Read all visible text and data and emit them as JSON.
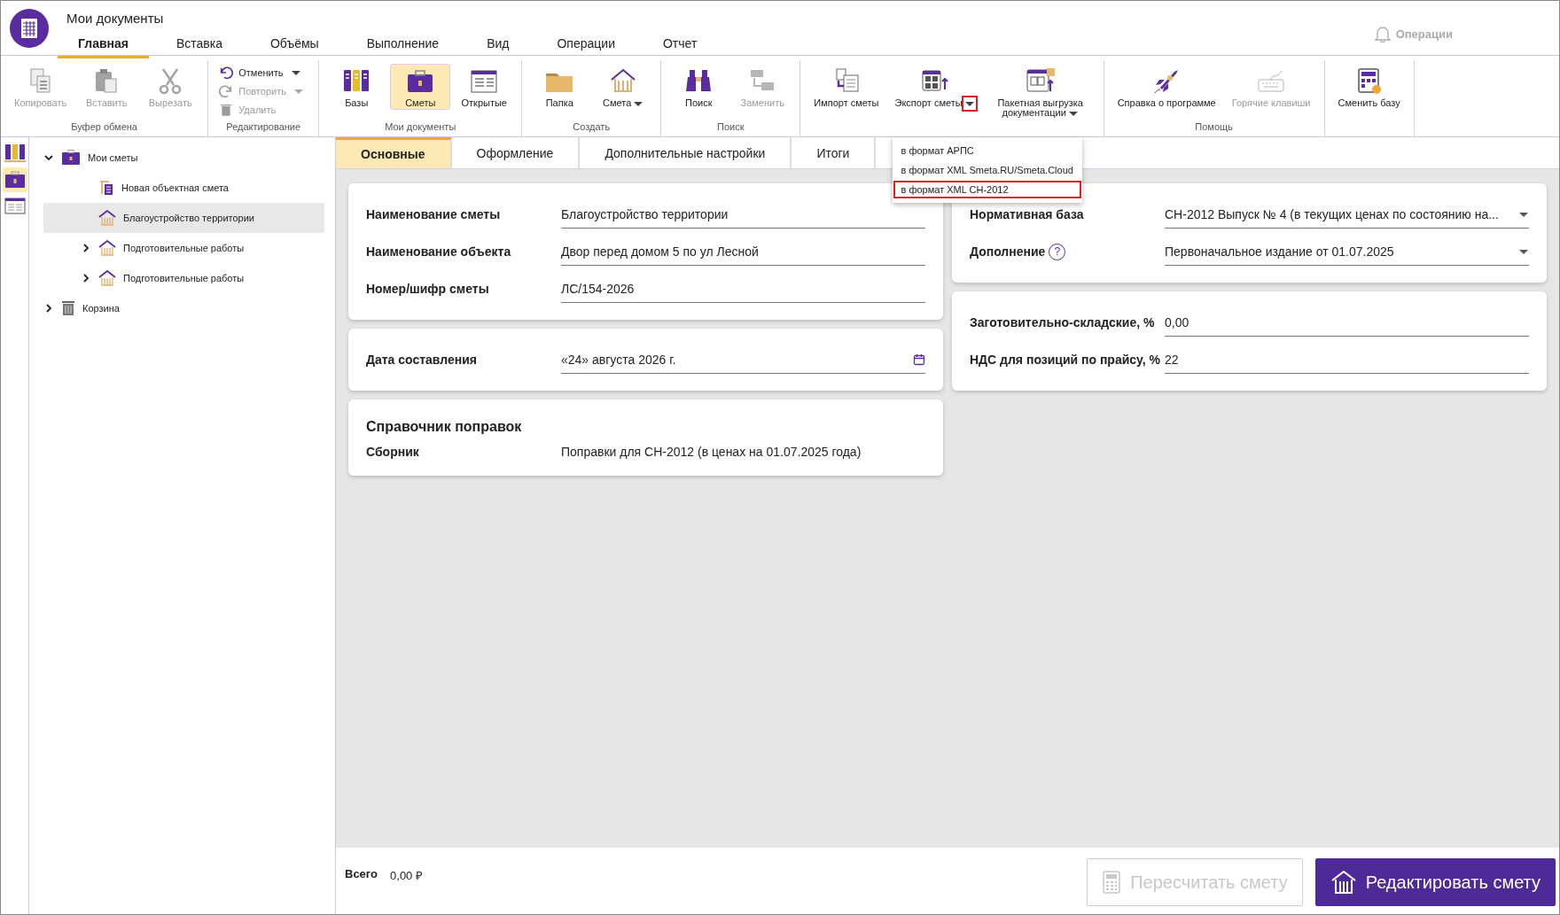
{
  "app": {
    "title": "Мои документы"
  },
  "menu_tabs": [
    {
      "label": "Главная",
      "selected": true
    },
    {
      "label": "Вставка",
      "selected": false
    },
    {
      "label": "Объёмы",
      "selected": false
    },
    {
      "label": "Выполнение",
      "selected": false
    },
    {
      "label": "Вид",
      "selected": false
    },
    {
      "label": "Операции",
      "selected": false
    },
    {
      "label": "Отчет",
      "selected": false
    }
  ],
  "notifications": {
    "label": "Операции"
  },
  "ribbon": {
    "groups": [
      {
        "label": "Буфер обмена",
        "kind": "large",
        "items": [
          {
            "label": "Копировать",
            "disabled": true
          },
          {
            "label": "Вставить",
            "disabled": true
          },
          {
            "label": "Вырезать",
            "disabled": true
          }
        ]
      },
      {
        "label": "Редактирование",
        "kind": "small",
        "items": [
          {
            "label": "Отменить",
            "disabled": false,
            "dropdown": true
          },
          {
            "label": "Повторить",
            "disabled": true,
            "dropdown": true
          },
          {
            "label": "Удалить",
            "disabled": true
          }
        ]
      },
      {
        "label": "Мои документы",
        "kind": "large",
        "items": [
          {
            "label": "Базы",
            "disabled": false,
            "selected": false
          },
          {
            "label": "Сметы",
            "disabled": false,
            "selected": true
          },
          {
            "label": "Открытые",
            "disabled": false,
            "selected": false
          }
        ]
      },
      {
        "label": "Создать",
        "kind": "large",
        "items": [
          {
            "label": "Папка",
            "disabled": false
          },
          {
            "label": "Смета",
            "disabled": false,
            "dropdown": true
          }
        ]
      },
      {
        "label": "Поиск",
        "kind": "large",
        "items": [
          {
            "label": "Поиск",
            "disabled": false
          },
          {
            "label": "Заменить",
            "disabled": true
          }
        ]
      },
      {
        "kind": "large",
        "items": [
          {
            "label": "Импорт сметы",
            "disabled": false
          },
          {
            "label": "Экспорт сметы",
            "disabled": false,
            "dropdown": true,
            "highlighted": true,
            "menu": [
              {
                "label": "в формат АРПС",
                "highlighted": false
              },
              {
                "label": "в формат XML Smeta.RU/Smeta.Cloud",
                "highlighted": false
              },
              {
                "label": "в формат XML СН-2012",
                "highlighted": true
              }
            ]
          },
          {
            "label": "Пакетная выгрузка документации",
            "disabled": false,
            "dropdown": true
          }
        ]
      },
      {
        "label": "Помощь",
        "kind": "large",
        "items": [
          {
            "label": "Справка о программе",
            "disabled": false
          },
          {
            "label": "Горячие клавиши",
            "disabled": true
          }
        ]
      },
      {
        "kind": "large",
        "items": [
          {
            "label": "Сменить базу",
            "disabled": false
          }
        ]
      }
    ]
  },
  "nav_strip": [
    {
      "selected": false
    },
    {
      "selected": true
    },
    {
      "selected": false
    }
  ],
  "tree": [
    {
      "kind": "folder",
      "label": "Мои сметы",
      "expanded": true,
      "selected": false,
      "children": [
        {
          "kind": "object",
          "label": "Новая объектная смета",
          "selected": false
        },
        {
          "kind": "estimate",
          "label": "Благоустройство территории",
          "selected": true
        },
        {
          "kind": "estimate",
          "label": "Подготовительные работы",
          "expanded": false,
          "selected": false
        },
        {
          "kind": "estimate",
          "label": "Подготовительные работы",
          "expanded": false,
          "selected": false
        }
      ]
    },
    {
      "kind": "trash",
      "label": "Корзина",
      "expanded": false,
      "selected": false
    }
  ],
  "content_tabs": [
    {
      "label": "Основные",
      "selected": true
    },
    {
      "label": "Оформление",
      "selected": false
    },
    {
      "label": "Дополнительные настройки",
      "selected": false
    },
    {
      "label": "Итоги",
      "selected": false
    }
  ],
  "left_cards": [
    {
      "fields": [
        {
          "kind": "text",
          "label": "Наименование сметы",
          "value": "Благоустройство территории"
        },
        {
          "kind": "text",
          "label": "Наименование объекта",
          "value": "Двор перед домом 5 по ул Лесной"
        },
        {
          "kind": "text",
          "label": "Номер/шифр сметы",
          "value": "ЛС/154-2026"
        }
      ]
    },
    {
      "fields": [
        {
          "kind": "date",
          "label": "Дата составления",
          "value": "«24» августа 2026 г."
        }
      ]
    },
    {
      "title": "Справочник поправок",
      "fields": [
        {
          "kind": "plain",
          "label": "Сборник",
          "value": "Поправки для СН-2012 (в ценах на 01.07.2025 года)"
        }
      ]
    }
  ],
  "right_cards": [
    {
      "fields": [
        {
          "kind": "select",
          "label": "Нормативная база",
          "value": "СН-2012 Выпуск № 4 (в текущих ценах по состоянию на..."
        },
        {
          "kind": "select",
          "label": "Дополнение",
          "help": "?",
          "value": "Первоначальное издание от 01.07.2025"
        }
      ]
    },
    {
      "fields": [
        {
          "kind": "text",
          "label": "Заготовительно-складские, %",
          "value": "0,00"
        },
        {
          "kind": "text",
          "label": "НДС для позиций по прайсу, %",
          "value": "22"
        }
      ]
    }
  ],
  "footer": {
    "total_label": "Всего",
    "total_value": "0,00 ₽",
    "buttons": [
      {
        "kind": "secondary",
        "label": "Пересчитать смету",
        "disabled": true
      },
      {
        "kind": "primary",
        "label": "Редактировать смету",
        "disabled": false
      }
    ]
  }
}
